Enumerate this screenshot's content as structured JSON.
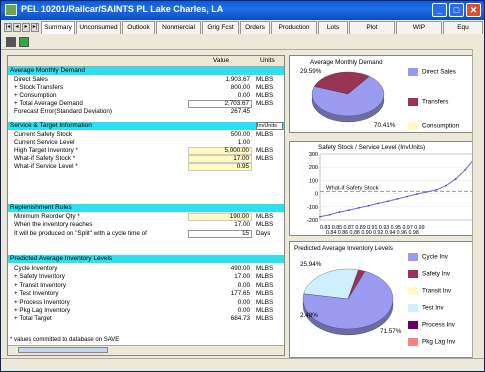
{
  "window": {
    "title": "PEL 10201/Railcar/SAINTS PL Lake Charles, LA",
    "buttons": {
      "minimize": "_",
      "maximize": "□",
      "close": "✕"
    }
  },
  "tabs": [
    "Summary",
    "Unconsumed",
    "Outlook",
    "Nonmercial",
    "Grig Fcst",
    "Orders",
    "Production",
    "Lots",
    "Plot",
    "WIP",
    "Equ"
  ],
  "nav": [
    "|◂",
    "◂",
    "▸",
    "▸|"
  ],
  "grid": {
    "col_value": "Value",
    "col_units": "Units",
    "sections": {
      "demand": "Average Monthly Demand",
      "service": "Service & Target Information",
      "replenishment": "Replenishment Rules",
      "inventory": "Predicted Average Inventory Levels"
    },
    "demand_rows": [
      {
        "label": "Direct Sales",
        "value": "1,903.67",
        "unit": "MLBS"
      },
      {
        "label": "+ Stock Transfers",
        "value": "800.00",
        "unit": "MLBS"
      },
      {
        "label": "+ Consumption",
        "value": "0.00",
        "unit": "MLBS"
      },
      {
        "label": "+ Total Average Demand",
        "value": "2,703.67",
        "unit": "MLBS"
      },
      {
        "label": "Forecast Error(Standard Deviation)",
        "value": "267.45",
        "unit": ""
      }
    ],
    "service_dropdown": "InvUnits",
    "service_rows": [
      {
        "label": "Current Safety Stock",
        "value": "500.00",
        "unit": "MLBS"
      },
      {
        "label": "Current Service Level",
        "value": "1.00",
        "unit": ""
      },
      {
        "label": "High Target Inventory *",
        "value": "5,000.00",
        "unit": "MLBS"
      },
      {
        "label": "What-if Safety Stock *",
        "value": "17.00",
        "unit": "MLBS"
      },
      {
        "label": "What-if Service Level *",
        "value": "0.95",
        "unit": ""
      }
    ],
    "replenishment_rows": [
      {
        "label": "Minimum Reorder Qty *",
        "value": "190.00",
        "unit": "MLBS"
      },
      {
        "label": "When the inventory reaches",
        "value": "17.00",
        "unit": "MLBS"
      },
      {
        "label": "It will be produced on \"Split\" with a cycle time of",
        "value": "15",
        "unit": "Days"
      }
    ],
    "inventory_rows": [
      {
        "label": "Cycle Inventory",
        "value": "490.00",
        "unit": "MLBS"
      },
      {
        "label": "+ Safety Inventory",
        "value": "17.00",
        "unit": "MLBS"
      },
      {
        "label": "+ Transit Inventory",
        "value": "0.00",
        "unit": "MLBS"
      },
      {
        "label": "+ Test Inventory",
        "value": "177.65",
        "unit": "MLBS"
      },
      {
        "label": "+ Process Inventory",
        "value": "0.00",
        "unit": "MLBS"
      },
      {
        "label": "+ Pkg Lag Inventory",
        "value": "0.00",
        "unit": "MLBS"
      },
      {
        "label": "+ Total Target",
        "value": "684.73",
        "unit": "MLBS"
      }
    ],
    "footnote": "* values committed to database on SAVE"
  },
  "chart_demand": {
    "title": "Average Monthly Demand",
    "pct_labels": [
      "29.59%",
      "70.41%"
    ],
    "legend": [
      "Direct Sales",
      "Transfers",
      "Consumption"
    ],
    "colors": [
      "#9a9af0",
      "#993355",
      "#fff9c4"
    ]
  },
  "chart_service": {
    "title": "Safety Stock / Service Level (InvUnits)",
    "series_label": "What-if Safety Stock",
    "yticks": [
      "300",
      "200",
      "100",
      "0",
      "-100",
      "-200"
    ],
    "xticks1": "0.83 0.85 0.87 0.89 0.91 0.93 0.95 0.97 0.99",
    "xticks2": "0.84 0.86 0.88 0.90 0.92 0.94 0.96 0.98"
  },
  "chart_inventory": {
    "title": "Predicted Average Inventory Levels",
    "pct_labels": [
      "25.94%",
      "2.48%",
      "71.57%"
    ],
    "legend": [
      "Cycle Inv",
      "Safety Inv",
      "Transit Inv",
      "Test Inv",
      "Process Inv",
      "Pkg Lag Inv"
    ],
    "colors": [
      "#9a9af0",
      "#993355",
      "#fff9c4",
      "#cfefff",
      "#660066",
      "#ff8080"
    ]
  },
  "chart_data": [
    {
      "type": "pie",
      "title": "Average Monthly Demand",
      "categories": [
        "Direct Sales",
        "Transfers",
        "Consumption"
      ],
      "values": [
        70.41,
        29.59,
        0
      ]
    },
    {
      "type": "line",
      "title": "Safety Stock / Service Level (InvUnits)",
      "x": [
        0.83,
        0.84,
        0.85,
        0.86,
        0.87,
        0.88,
        0.89,
        0.9,
        0.91,
        0.92,
        0.93,
        0.94,
        0.95,
        0.96,
        0.97,
        0.98,
        0.99
      ],
      "series": [
        {
          "name": "What-if Safety Stock",
          "values": [
            -175,
            -160,
            -140,
            -125,
            -108,
            -92,
            -74,
            -58,
            -40,
            -22,
            -4,
            12,
            28,
            60,
            110,
            180,
            270
          ]
        }
      ],
      "ylim": [
        -200,
        300
      ],
      "yticks": [
        300,
        200,
        100,
        0,
        -100,
        -200
      ]
    },
    {
      "type": "pie",
      "title": "Predicted Average Inventory Levels",
      "categories": [
        "Cycle Inv",
        "Safety Inv",
        "Transit Inv",
        "Test Inv",
        "Process Inv",
        "Pkg Lag Inv"
      ],
      "values": [
        71.57,
        2.48,
        0,
        25.94,
        0,
        0
      ]
    }
  ]
}
